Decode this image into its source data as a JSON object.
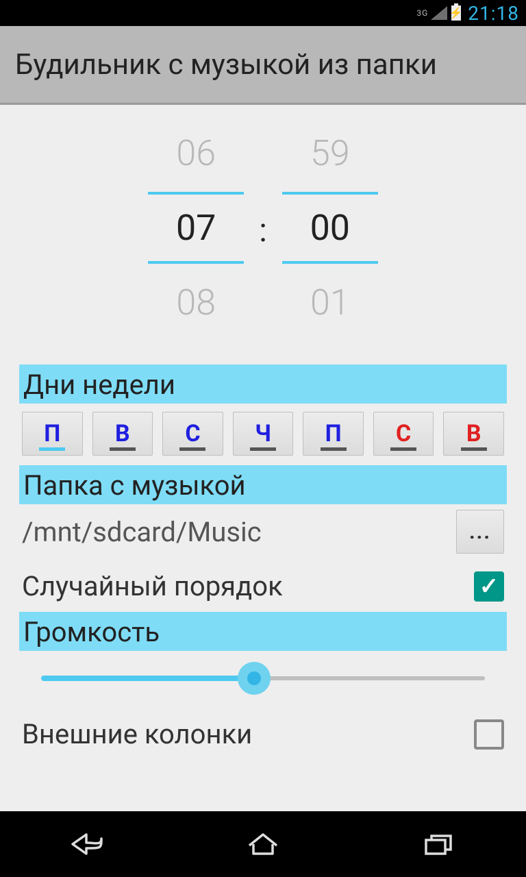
{
  "status": {
    "network_label": "3G",
    "clock": "21:18"
  },
  "header": {
    "title": "Будильник с музыкой из папки"
  },
  "time_picker": {
    "hour_prev": "06",
    "hour": "07",
    "hour_next": "08",
    "minute_prev": "59",
    "minute": "00",
    "minute_next": "01",
    "separator": ":"
  },
  "sections": {
    "days_title": "Дни недели",
    "folder_title": "Папка с музыкой",
    "volume_title": "Громкость"
  },
  "days": [
    {
      "label": "П",
      "weekend": false,
      "selected": true
    },
    {
      "label": "В",
      "weekend": false,
      "selected": false
    },
    {
      "label": "С",
      "weekend": false,
      "selected": false
    },
    {
      "label": "Ч",
      "weekend": false,
      "selected": false
    },
    {
      "label": "П",
      "weekend": false,
      "selected": false
    },
    {
      "label": "С",
      "weekend": true,
      "selected": false
    },
    {
      "label": "В",
      "weekend": true,
      "selected": false
    }
  ],
  "folder": {
    "path": "/mnt/sdcard/Music",
    "browse_label": "..."
  },
  "shuffle": {
    "label": "Случайный порядок",
    "checked": true
  },
  "volume": {
    "percent": 48
  },
  "external_speakers": {
    "label": "Внешние колонки",
    "checked": false
  },
  "colors": {
    "accent": "#4ecaf0",
    "highlight": "#7fdcf6",
    "holo_blue": "#33b5e5",
    "teal": "#009688"
  }
}
